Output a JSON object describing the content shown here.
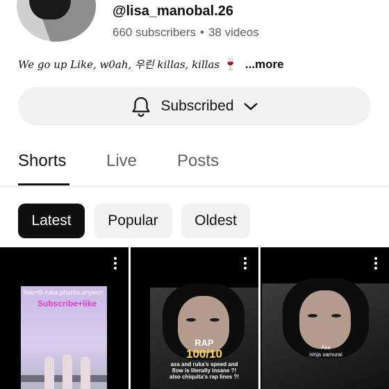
{
  "channel": {
    "handle": "@lisa_manobal.26",
    "subscribers": "660 subscribers",
    "separator": "•",
    "videos": "38 videos",
    "bio": "We go up Like, w0ah, 우린 killas, killas",
    "bio_emoji": "🍷",
    "bio_more": "...more"
  },
  "subscribe_button": {
    "label": "Subscribed"
  },
  "tabs": [
    {
      "label": "Shorts",
      "active": true
    },
    {
      "label": "Live",
      "active": false
    },
    {
      "label": "Posts",
      "active": false
    }
  ],
  "filters": [
    {
      "label": "Latest",
      "active": true
    },
    {
      "label": "Popular",
      "active": false
    },
    {
      "label": "Oldest",
      "active": false
    }
  ],
  "shorts": [
    {
      "overlay_line1": "TeamB-ruka.pharita.ahyeon",
      "overlay_line2": "Subscribe+like"
    },
    {
      "rap_title": "RAP",
      "rap_score": "100/10",
      "caption": "asa and ruka's speed and flow is literally insane ?! also chiquita's rap lines ?!"
    },
    {
      "caption_line1": "Asa",
      "caption_line2": "ninja samurai"
    }
  ],
  "colors": {
    "text": "#0f0f0f",
    "secondary": "#606060",
    "chip_bg": "#f2f2f2",
    "chip_active": "#0f0f0f"
  }
}
